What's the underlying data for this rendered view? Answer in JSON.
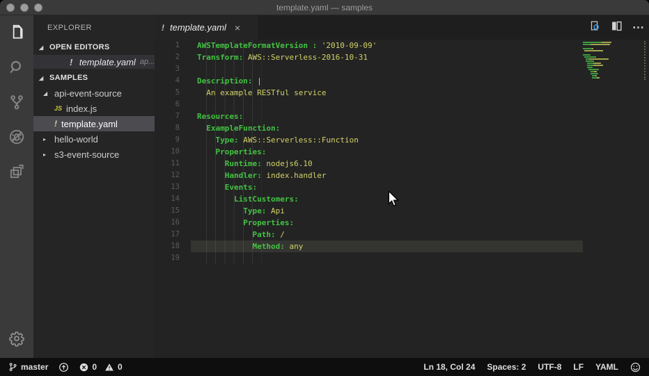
{
  "window": {
    "title": "template.yaml — samples"
  },
  "activity_bar": {
    "items": [
      {
        "name": "explorer",
        "active": true
      },
      {
        "name": "search",
        "active": false
      },
      {
        "name": "source-control",
        "active": false
      },
      {
        "name": "debug",
        "active": false
      },
      {
        "name": "extensions",
        "active": false
      }
    ]
  },
  "icons": {
    "expanded_twistie": "◢",
    "collapsed_twistie": "▸",
    "js_badge": "JS",
    "modified_badge": "!",
    "tab_close": "×",
    "more_actions": "⋯"
  },
  "sidebar": {
    "title": "EXPLORER",
    "open_editors": {
      "header": "OPEN EDITORS",
      "item": {
        "badge": "!",
        "name": "template.yaml",
        "detail": "ap..."
      }
    },
    "section": {
      "header": "SAMPLES"
    },
    "tree": [
      {
        "label": "api-event-source"
      },
      {
        "label": "index.js"
      },
      {
        "label": "template.yaml"
      },
      {
        "label": "hello-world"
      },
      {
        "label": "s3-event-source"
      }
    ]
  },
  "editor": {
    "tab": {
      "badge": "!",
      "label": "template.yaml",
      "close": "×"
    },
    "colors": {
      "key": "#43c343",
      "value": "#d2d269",
      "current_line_bg": "#343430"
    },
    "code": {
      "current_line": 18,
      "lines": [
        [
          [
            "k",
            "AWSTemplateFormatVersion :"
          ],
          [
            "v",
            " '2010-09-09'"
          ]
        ],
        [
          [
            "k",
            "Transform:"
          ],
          [
            "v",
            " AWS::Serverless-2016-10-31"
          ]
        ],
        [],
        [
          [
            "k",
            "Description:"
          ],
          [
            "v",
            " |"
          ]
        ],
        [
          [
            "w",
            "  "
          ],
          [
            "v",
            "An example RESTful service"
          ]
        ],
        [],
        [
          [
            "k",
            "Resources:"
          ]
        ],
        [
          [
            "w",
            "  "
          ],
          [
            "k",
            "ExampleFunction:"
          ]
        ],
        [
          [
            "w",
            "    "
          ],
          [
            "k",
            "Type:"
          ],
          [
            "v",
            " AWS::Serverless::Function"
          ]
        ],
        [
          [
            "w",
            "    "
          ],
          [
            "k",
            "Properties:"
          ]
        ],
        [
          [
            "w",
            "      "
          ],
          [
            "k",
            "Runtime:"
          ],
          [
            "v",
            " nodejs6.10"
          ]
        ],
        [
          [
            "w",
            "      "
          ],
          [
            "k",
            "Handler:"
          ],
          [
            "v",
            " index.handler"
          ]
        ],
        [
          [
            "w",
            "      "
          ],
          [
            "k",
            "Events:"
          ]
        ],
        [
          [
            "w",
            "        "
          ],
          [
            "k",
            "ListCustomers:"
          ]
        ],
        [
          [
            "w",
            "          "
          ],
          [
            "k",
            "Type:"
          ],
          [
            "v",
            " Api"
          ]
        ],
        [
          [
            "w",
            "          "
          ],
          [
            "k",
            "Properties:"
          ]
        ],
        [
          [
            "w",
            "            "
          ],
          [
            "k",
            "Path:"
          ],
          [
            "v",
            " /"
          ]
        ],
        [
          [
            "w",
            "            "
          ],
          [
            "k",
            "Method:"
          ],
          [
            "v",
            " any"
          ]
        ],
        []
      ]
    }
  },
  "status_bar": {
    "branch": "master",
    "errors": "0",
    "warnings": "0",
    "position": "Ln 18, Col 24",
    "indentation": "Spaces: 2",
    "encoding": "UTF-8",
    "eol": "LF",
    "language": "YAML"
  }
}
